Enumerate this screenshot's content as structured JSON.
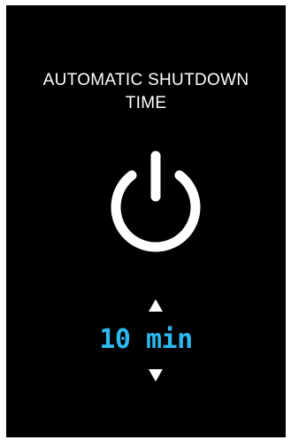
{
  "screen": {
    "title_line1": "AUTOMATIC SHUTDOWN",
    "title_line2": "TIME",
    "power_icon": "power-icon",
    "increase_icon": "triangle-up-icon",
    "decrease_icon": "triangle-down-icon"
  },
  "timer": {
    "value": "10 min"
  },
  "colors": {
    "background": "#000000",
    "text": "#ffffff",
    "accent": "#2eb8f0"
  }
}
